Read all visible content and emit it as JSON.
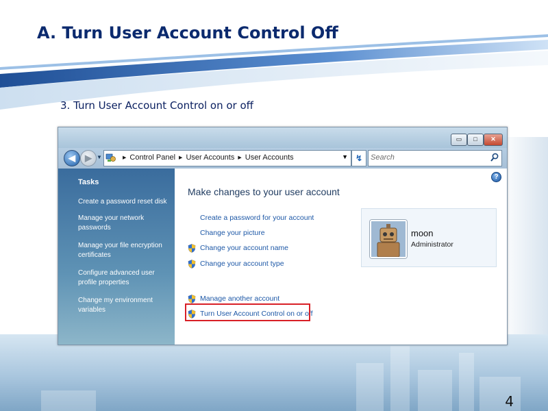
{
  "slide": {
    "title": "A. Turn User Account Control Off",
    "subtitle": "3. Turn User Account Control on or off",
    "page_number": "4"
  },
  "window": {
    "buttons": {
      "minimize_glyph": "▭",
      "maximize_glyph": "□",
      "close_glyph": "✕"
    },
    "nav": {
      "back_glyph": "◀",
      "forward_glyph": "▶",
      "dropdown_glyph": "▼"
    },
    "address": {
      "crumbs": [
        "Control Panel",
        "User Accounts",
        "User Accounts"
      ],
      "separator": "▶",
      "dropdown_glyph": "▼",
      "refresh_glyph": "↯"
    },
    "search": {
      "placeholder": "Search",
      "value": ""
    },
    "sidebar": {
      "title": "Tasks",
      "items": [
        "Create a password reset disk",
        "Manage your network passwords",
        "Manage your file encryption certificates",
        "Configure advanced user profile properties",
        "Change my environment variables"
      ]
    },
    "content": {
      "help_glyph": "?",
      "heading": "Make changes to your user account",
      "actions": [
        {
          "label": "Create a password for your account",
          "shield": false
        },
        {
          "label": "Change your picture",
          "shield": false
        },
        {
          "label": "Change your account name",
          "shield": true
        },
        {
          "label": "Change your account type",
          "shield": true
        },
        {
          "label": "Manage another account",
          "shield": true
        },
        {
          "label": "Turn User Account Control on or off",
          "shield": true
        }
      ]
    },
    "user": {
      "name": "moon",
      "role": "Administrator"
    }
  },
  "colors": {
    "title": "#0b2a6e",
    "link": "#1c57a6",
    "highlight": "#d81f26",
    "sidebar": "#3a6c9d"
  },
  "icons": {
    "shield": "uac-shield-icon",
    "search": "magnifier-icon",
    "help": "help-icon",
    "control_panel": "control-panel-icon"
  }
}
